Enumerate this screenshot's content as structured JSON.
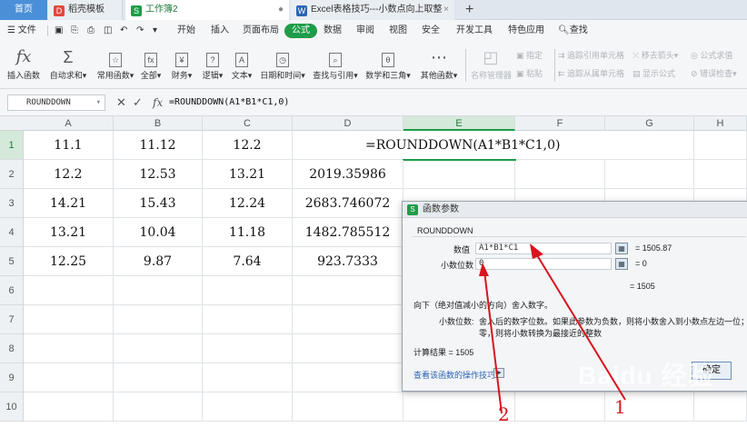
{
  "tabs": [
    {
      "label": "首页"
    },
    {
      "label": "稻壳模板"
    },
    {
      "label": "工作簿2"
    },
    {
      "label": "Excel表格技巧---小数点向上取整"
    }
  ],
  "menu": {
    "file": "文件",
    "items": [
      "开始",
      "插入",
      "页面布局",
      "公式",
      "数据",
      "审阅",
      "视图",
      "安全",
      "开发工具",
      "特色应用"
    ],
    "search": "查找"
  },
  "ribbon": {
    "buttons": [
      "插入函数",
      "自动求和",
      "常用函数",
      "全部",
      "财务",
      "逻辑",
      "文本",
      "日期和时间",
      "查找与引用",
      "数学和三角",
      "其他函数"
    ],
    "disabled": [
      "名称管理器",
      "指定",
      "粘贴",
      "追踪引用单元格",
      "移去箭头",
      "公式求值",
      "追踪从属单元格",
      "显示公式",
      "错误检查"
    ]
  },
  "formula_bar": {
    "name_box": "ROUNDDOWN",
    "formula": "=ROUNDDOWN(A1*B1*C1,0)"
  },
  "columns": [
    "A",
    "B",
    "C",
    "D",
    "E",
    "F",
    "G",
    "H"
  ],
  "rows": [
    "1",
    "2",
    "3",
    "4",
    "5",
    "6",
    "7",
    "8",
    "9",
    "10"
  ],
  "cells": [
    [
      "11.1",
      "11.12",
      "12.2",
      "=ROUNDDOWN(A1*B1*C1,0)"
    ],
    [
      "12.2",
      "12.53",
      "13.21",
      "2019.35986"
    ],
    [
      "14.21",
      "15.43",
      "12.24",
      "2683.746072"
    ],
    [
      "13.21",
      "10.04",
      "11.18",
      "1482.785512"
    ],
    [
      "12.25",
      "9.87",
      "7.64",
      "923.7333"
    ]
  ],
  "dialog": {
    "title": "函数参数",
    "func_name": "ROUNDDOWN",
    "arg1_label": "数值",
    "arg1_value": "A1*B1*C1",
    "arg1_result": "= 1505.87",
    "arg2_label": "小数位数",
    "arg2_value": "0",
    "arg2_result": "= 0",
    "overall_result": "= 1505",
    "desc": "向下（绝对值减小的方向）舍入数字。",
    "arg_desc_label": "小数位数:",
    "arg_desc_line1": "舍入后的数字位数。如果此参数为负数，则将小数舍入到小数点左边一位；如",
    "arg_desc_line2": "零，则将小数转换为最接近的整数",
    "calc_result": "计算结果 = 1505",
    "help_link": "查看该函数的操作技巧",
    "ok": "确定"
  },
  "annotations": [
    "1",
    "2"
  ],
  "watermark": "Baidu 经验",
  "colors": {
    "accent": "#1f9c4a",
    "arrow": "#d8141d"
  }
}
